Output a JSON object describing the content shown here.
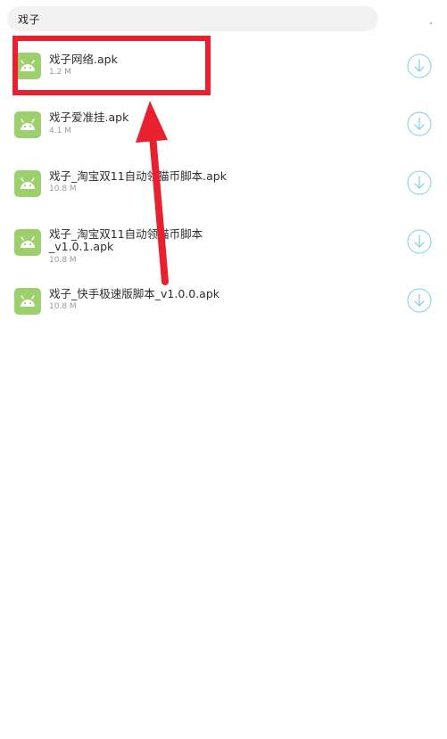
{
  "search": {
    "query": "戏子"
  },
  "results": [
    {
      "title": "戏子网络.apk",
      "size": "1.2 M"
    },
    {
      "title": "戏子爱准挂.apk",
      "size": "4.1 M"
    },
    {
      "title": "戏子_淘宝双11自动领猫币脚本.apk",
      "size": "10.8 M"
    },
    {
      "title_line1": "戏子_淘宝双11自动领猫币脚本",
      "title_line2": "_v1.0.1.apk",
      "size": "10.8 M"
    },
    {
      "title": "戏子_快手极速版脚本_v1.0.0.apk",
      "size": "10.8 M"
    }
  ],
  "colors": {
    "app_icon": "#9bd06d",
    "download_icon": "#7fcde8",
    "annotation": "#e8202f"
  },
  "icons": {
    "app": "android-icon",
    "download": "download-circle-icon"
  }
}
